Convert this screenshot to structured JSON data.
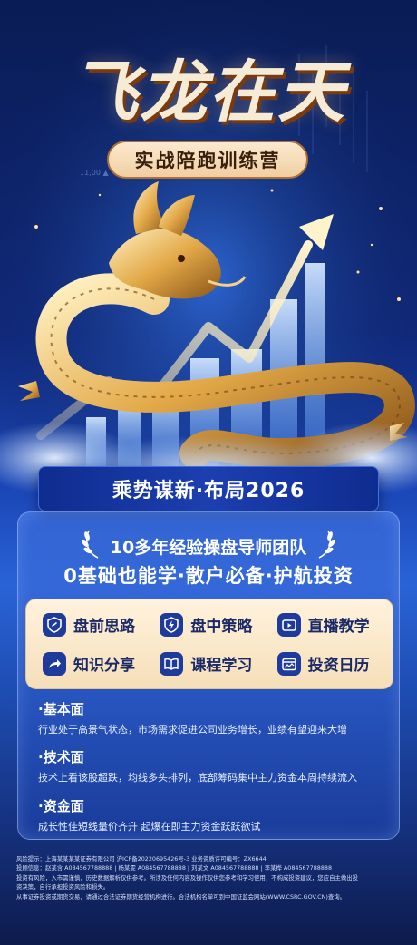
{
  "hero": {
    "title": "飞龙在天",
    "subtitle": "实战陪跑训练营",
    "bg_ticker": "11,00 ▲"
  },
  "banner": {
    "text": "乘势谋新·布局2026"
  },
  "card": {
    "headline_1": "10多年经验操盘导师团队",
    "headline_2": "0基础也能学·散户必备·护航投资",
    "features": [
      {
        "label": "盘前思路",
        "icon": "link-shield-icon"
      },
      {
        "label": "盘中策略",
        "icon": "lightning-shield-icon"
      },
      {
        "label": "直播教学",
        "icon": "tv-play-icon"
      },
      {
        "label": "知识分享",
        "icon": "share-arrow-icon"
      },
      {
        "label": "课程学习",
        "icon": "open-book-icon"
      },
      {
        "label": "投资日历",
        "icon": "calendar-chart-icon"
      }
    ],
    "sections": [
      {
        "heading": "·基本面",
        "body": "行业处于高景气状态，市场需求促进公司业务增长，业绩有望迎来大增"
      },
      {
        "heading": "·技术面",
        "body": "技术上看该股超跌，均线多头排列，底部筹码集中主力资金本周持续流入"
      },
      {
        "heading": "·资金面",
        "body": "成长性佳短线量价齐升 起爆在即主力资金跃跃欲试"
      }
    ]
  },
  "disclaimer": {
    "lines": [
      "风险提示：上海某某某某证券有限公司    沪ICP备20220695426号-3    业务资质许可编号：ZX6644",
      "投顾信息：赵某含 A084567788888  |  杨某雯 A084567788888  |  刘某文 A084567788888  |  李某桦 A084567788888",
      "投资有风险，入市需谨慎，历史数据解析仅供参考。所涉及任何内容及操作仅供您参考和学习使用，不构成投资建议，您应自主做出投",
      "资决策，自行承担投资风险和损失。",
      "从事证券投资或期货交易，请通过合法证券期货经营机构进行。合法机构名单可到中国证监会网站(WWW.CSRC.GOV.CN)查询。"
    ]
  },
  "colors": {
    "gold": "#f6dfb9",
    "navy": "#1e3a9a",
    "banner_blue": "#1c3fb0"
  }
}
